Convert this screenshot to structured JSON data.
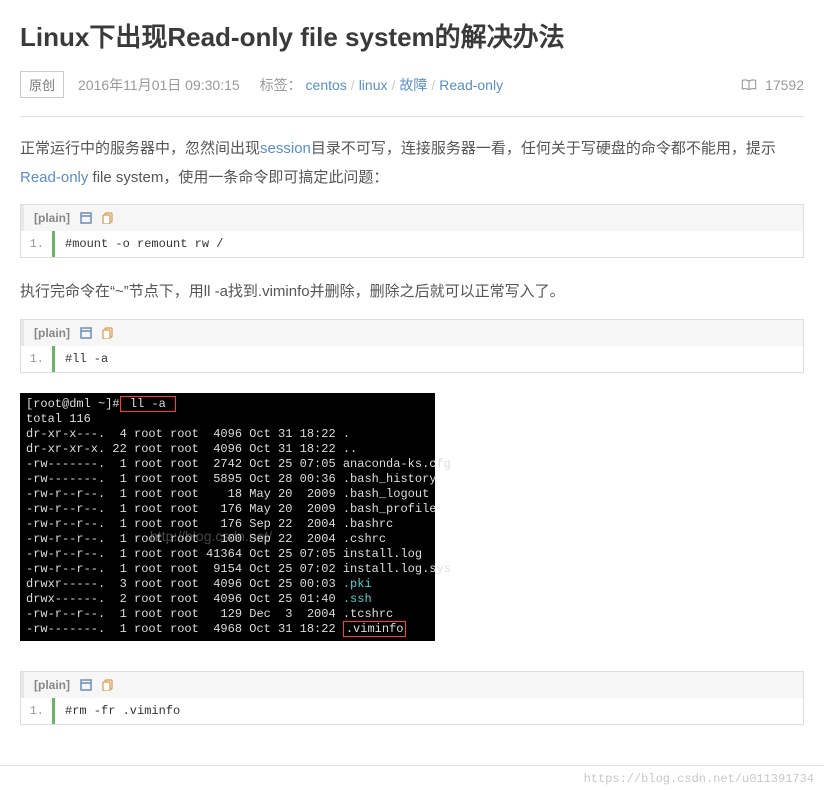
{
  "title": "Linux下出现Read-only file system的解决办法",
  "badge": "原创",
  "date": "2016年11月01日 09:30:15",
  "tags_label": "标签：",
  "tags": [
    "centos",
    "linux",
    "故障",
    "Read-only"
  ],
  "views": "17592",
  "intro": {
    "p1a": "正常运行中的服务器中，忽然间出现",
    "session": "session",
    "p1b": "目录不可写，连接服务器一看，任何关于写硬盘的命令都不能用，提示",
    "readonly": "Read-only",
    "p1c": " file system，使用一条命令即可搞定此问题：",
    "p2": "执行完命令在“~”节点下，用ll -a找到.viminfo并删除，删除之后就可以正常写入了。"
  },
  "code_header_label": "[plain]",
  "line_no": "1.",
  "codes": {
    "c1": "#mount -o remount rw /",
    "c2": "#ll -a",
    "c3": "#rm -fr .viminfo"
  },
  "terminal": {
    "prompt": "[root@dml ~]#",
    "cmd": " ll -a ",
    "lines": [
      "total 116",
      "dr-xr-x---.  4 root root  4096 Oct 31 18:22 .",
      "dr-xr-xr-x. 22 root root  4096 Oct 31 18:22 ..",
      "-rw-------.  1 root root  2742 Oct 25 07:05 anaconda-ks.cfg",
      "-rw-------.  1 root root  5895 Oct 28 00:36 .bash_history",
      "-rw-r--r--.  1 root root    18 May 20  2009 .bash_logout",
      "-rw-r--r--.  1 root root   176 May 20  2009 .bash_profile",
      "-rw-r--r--.  1 root root   176 Sep 22  2004 .bashrc",
      "-rw-r--r--.  1 root root   100 Sep 22  2004 .cshrc",
      "-rw-r--r--.  1 root root 41364 Oct 25 07:05 install.log",
      "-rw-r--r--.  1 root root  9154 Oct 25 07:02 install.log.sys",
      "drwxr-----.  3 root root  4096 Oct 25 00:03 ",
      "drwx------.  2 root root  4096 Oct 25 01:40 ",
      "-rw-r--r--.  1 root root   129 Dec  3  2004 .tcshrc",
      "-rw-------.  1 root root  4968 Oct 31 18:22 "
    ],
    "pki": ".pki",
    "ssh": ".ssh",
    "viminfo": ".viminfo",
    "watermark": "http://blog.csdn.net/"
  },
  "footer_url": "https://blog.csdn.net/u011391734"
}
